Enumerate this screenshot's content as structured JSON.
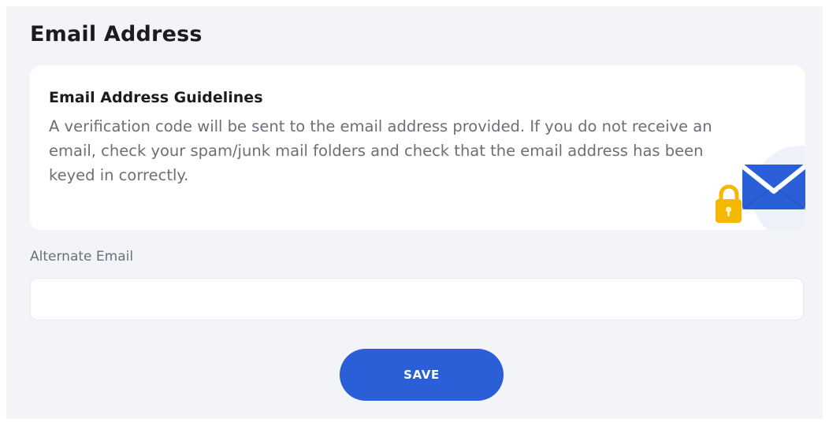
{
  "page": {
    "title": "Email Address"
  },
  "guidelines": {
    "title": "Email Address Guidelines",
    "body": "A verification code will be sent to the email address provided. If you do not receive an email, check your spam/junk mail folders and check that the email address has been keyed in correctly.",
    "illustration_icon": "envelope-lock-icon"
  },
  "form": {
    "alternate_email_label": "Alternate Email",
    "alternate_email_value": "",
    "alternate_email_placeholder": ""
  },
  "actions": {
    "save_label": "SAVE"
  },
  "colors": {
    "background": "#f3f4f8",
    "card": "#ffffff",
    "primary": "#2a5fd8",
    "title_text": "#1a1c22",
    "muted_text": "#6a6f7a",
    "lock": "#f5b800"
  }
}
